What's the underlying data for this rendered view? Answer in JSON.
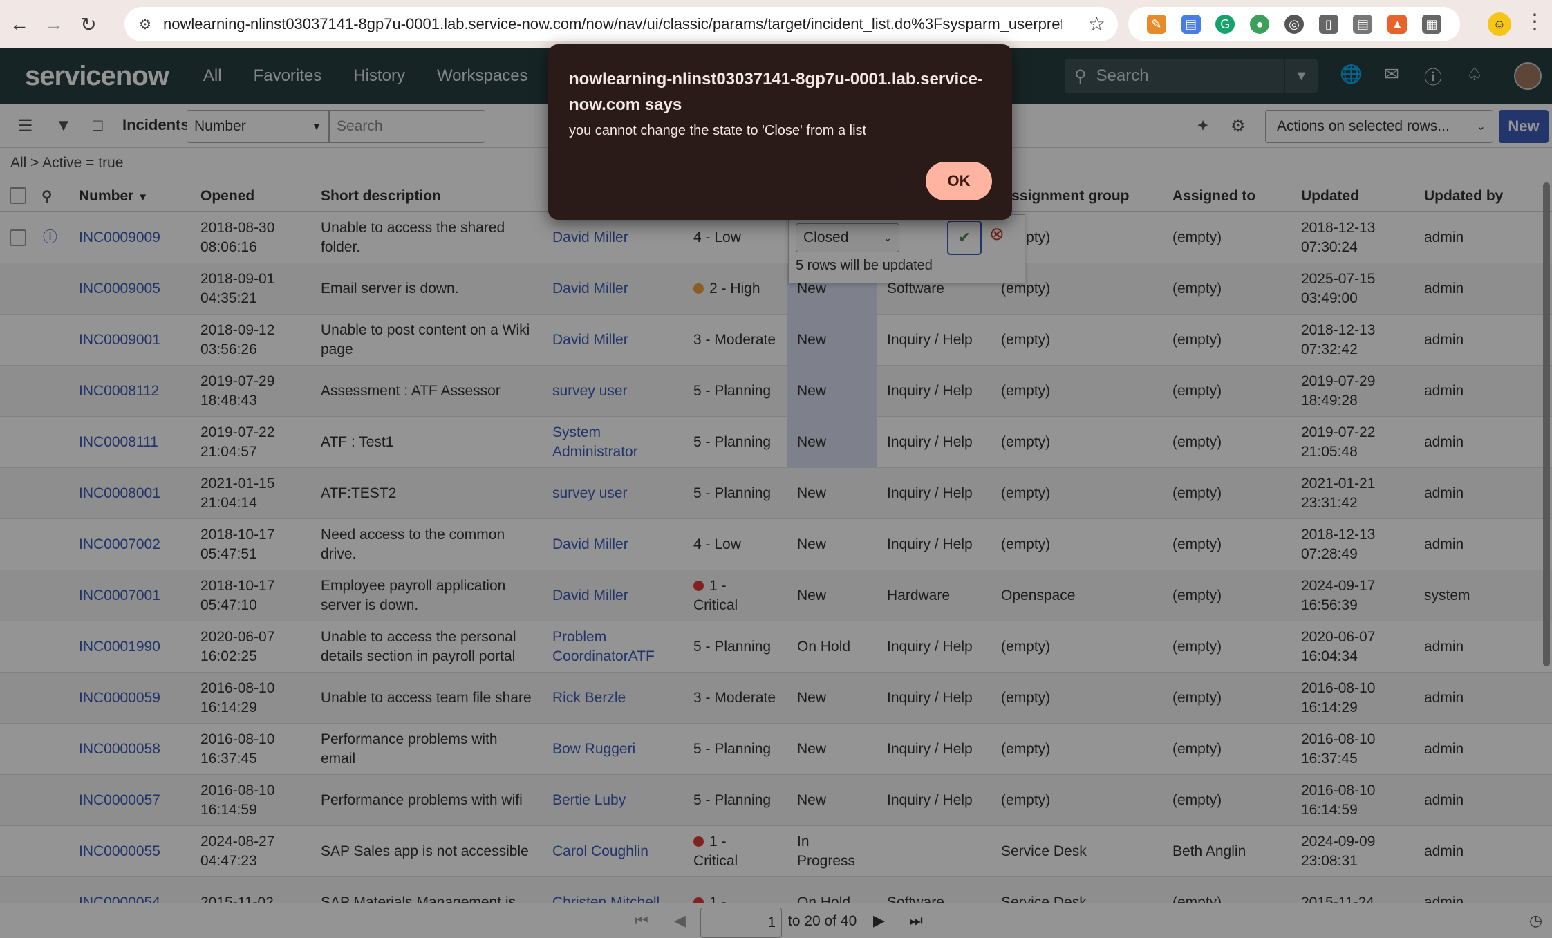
{
  "browser": {
    "url": "nowlearning-nlinst03037141-8gp7u-0001.lab.service-now.com/now/nav/ui/classic/params/target/incident_list.do%3Fsysparm_userpref_mod..."
  },
  "header": {
    "logo": "servicenow",
    "nav": [
      "All",
      "Favorites",
      "History",
      "Workspaces"
    ],
    "search_placeholder": "Search"
  },
  "toolbar": {
    "title": "Incidents",
    "field_select": "Number",
    "search_placeholder": "Search",
    "actions_select": "Actions on selected rows...",
    "new_label": "New"
  },
  "breadcrumb": "All > Active = true",
  "columns": {
    "number": "Number",
    "opened": "Opened",
    "short_description": "Short description",
    "assignment_group": "Assignment group",
    "assigned_to": "Assigned to",
    "updated": "Updated",
    "updated_by": "Updated by"
  },
  "rows": [
    {
      "number": "INC0009009",
      "opened": "2018-08-30\n08:06:16",
      "desc": "Unable to access the shared\nfolder.",
      "caller": "David Miller",
      "priority": "4 - Low",
      "pcolor": "",
      "state": "",
      "category": "",
      "group": "(empty)",
      "assigned": "(empty)",
      "updated": "2018-12-13\n07:30:24",
      "by": "admin"
    },
    {
      "number": "INC0009005",
      "opened": "2018-09-01\n04:35:21",
      "desc": "Email server is down.",
      "caller": "David Miller",
      "priority": "2 - High",
      "pcolor": "#e8a33d",
      "state": "New",
      "category": "Software",
      "group": "(empty)",
      "assigned": "(empty)",
      "updated": "2025-07-15\n03:49:00",
      "by": "admin"
    },
    {
      "number": "INC0009001",
      "opened": "2018-09-12\n03:56:26",
      "desc": "Unable to post content on a Wiki\npage",
      "caller": "David Miller",
      "priority": "3 - Moderate",
      "pcolor": "",
      "state": "New",
      "category": "Inquiry / Help",
      "group": "(empty)",
      "assigned": "(empty)",
      "updated": "2018-12-13\n07:32:42",
      "by": "admin"
    },
    {
      "number": "INC0008112",
      "opened": "2019-07-29\n18:48:43",
      "desc": "Assessment : ATF Assessor",
      "caller": "survey user",
      "priority": "5 - Planning",
      "pcolor": "",
      "state": "New",
      "category": "Inquiry / Help",
      "group": "(empty)",
      "assigned": "(empty)",
      "updated": "2019-07-29\n18:49:28",
      "by": "admin"
    },
    {
      "number": "INC0008111",
      "opened": "2019-07-22\n21:04:57",
      "desc": "ATF : Test1",
      "caller": "System\nAdministrator",
      "priority": "5 - Planning",
      "pcolor": "",
      "state": "New",
      "category": "Inquiry / Help",
      "group": "(empty)",
      "assigned": "(empty)",
      "updated": "2019-07-22\n21:05:48",
      "by": "admin"
    },
    {
      "number": "INC0008001",
      "opened": "2021-01-15\n21:04:14",
      "desc": "ATF:TEST2",
      "caller": "survey user",
      "priority": "5 - Planning",
      "pcolor": "",
      "state": "New",
      "category": "Inquiry / Help",
      "group": "(empty)",
      "assigned": "(empty)",
      "updated": "2021-01-21\n23:31:42",
      "by": "admin"
    },
    {
      "number": "INC0007002",
      "opened": "2018-10-17\n05:47:51",
      "desc": "Need access to the common\ndrive.",
      "caller": "David Miller",
      "priority": "4 - Low",
      "pcolor": "",
      "state": "New",
      "category": "Inquiry / Help",
      "group": "(empty)",
      "assigned": "(empty)",
      "updated": "2018-12-13\n07:28:49",
      "by": "admin"
    },
    {
      "number": "INC0007001",
      "opened": "2018-10-17\n05:47:10",
      "desc": "Employee payroll application\nserver is down.",
      "caller": "David Miller",
      "priority": "1 -\nCritical",
      "pcolor": "#e03a3a",
      "state": "New",
      "category": "Hardware",
      "group": "Openspace",
      "assigned": "(empty)",
      "updated": "2024-09-17\n16:56:39",
      "by": "system"
    },
    {
      "number": "INC0001990",
      "opened": "2020-06-07\n16:02:25",
      "desc": "Unable to access the personal\ndetails section in payroll portal",
      "caller": "Problem\nCoordinatorATF",
      "priority": "5 - Planning",
      "pcolor": "",
      "state": "On Hold",
      "category": "Inquiry / Help",
      "group": "(empty)",
      "assigned": "(empty)",
      "updated": "2020-06-07\n16:04:34",
      "by": "admin"
    },
    {
      "number": "INC0000059",
      "opened": "2016-08-10\n16:14:29",
      "desc": "Unable to access team file share",
      "caller": "Rick Berzle",
      "priority": "3 - Moderate",
      "pcolor": "",
      "state": "New",
      "category": "Inquiry / Help",
      "group": "(empty)",
      "assigned": "(empty)",
      "updated": "2016-08-10\n16:14:29",
      "by": "admin"
    },
    {
      "number": "INC0000058",
      "opened": "2016-08-10\n16:37:45",
      "desc": "Performance problems with\nemail",
      "caller": "Bow Ruggeri",
      "priority": "5 - Planning",
      "pcolor": "",
      "state": "New",
      "category": "Inquiry / Help",
      "group": "(empty)",
      "assigned": "(empty)",
      "updated": "2016-08-10\n16:37:45",
      "by": "admin"
    },
    {
      "number": "INC0000057",
      "opened": "2016-08-10\n16:14:59",
      "desc": "Performance problems with wifi",
      "caller": "Bertie Luby",
      "priority": "5 - Planning",
      "pcolor": "",
      "state": "New",
      "category": "Inquiry / Help",
      "group": "(empty)",
      "assigned": "(empty)",
      "updated": "2016-08-10\n16:14:59",
      "by": "admin"
    },
    {
      "number": "INC0000055",
      "opened": "2024-08-27\n04:47:23",
      "desc": "SAP Sales app is not accessible",
      "caller": "Carol Coughlin",
      "priority": "1 -\nCritical",
      "pcolor": "#e03a3a",
      "state": "In\nProgress",
      "category": "",
      "group": "Service Desk",
      "assigned": "Beth Anglin",
      "updated": "2024-09-09\n23:08:31",
      "by": "admin"
    },
    {
      "number": "INC0000054",
      "opened": "2015-11-02",
      "desc": "SAP Materials Management is",
      "caller": "Christen Mitchell",
      "priority": "1 -",
      "pcolor": "#e03a3a",
      "state": "On Hold",
      "category": "Software",
      "group": "Service Desk",
      "assigned": "(empty)",
      "updated": "2015-11-24",
      "by": "admin"
    }
  ],
  "inline_edit": {
    "value": "Closed",
    "note": "5 rows will be updated"
  },
  "pager": {
    "page": "1",
    "text": "to 20 of 40"
  },
  "alert": {
    "title": "nowlearning-nlinst03037141-8gp7u-0001.lab.service-now.com says",
    "message": "you cannot change the state to 'Close' from a list",
    "ok": "OK"
  }
}
